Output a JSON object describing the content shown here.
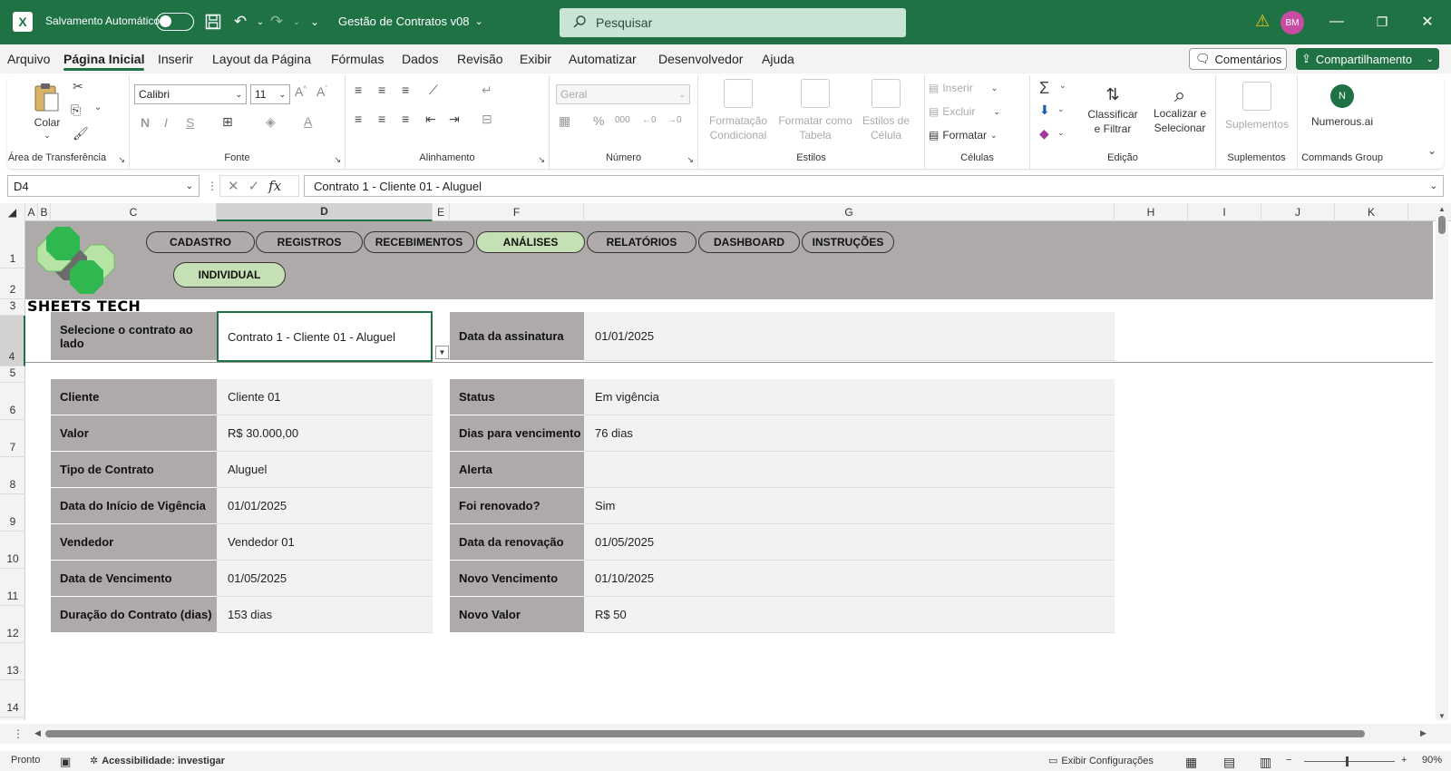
{
  "titlebar": {
    "autosave_label": "Salvamento Automático",
    "doc_title": "Gestão de Contratos v08",
    "search_placeholder": "Pesquisar",
    "avatar_initials": "BM",
    "brand_color": "#1f7244"
  },
  "menu": {
    "items": [
      "Arquivo",
      "Página Inicial",
      "Inserir",
      "Layout da Página",
      "Fórmulas",
      "Dados",
      "Revisão",
      "Exibir",
      "Automatizar",
      "Desenvolvedor",
      "Ajuda"
    ],
    "active": "Página Inicial",
    "comments_label": "Comentários",
    "share_label": "Compartilhamento"
  },
  "ribbon": {
    "clipboard": {
      "paste_label": "Colar",
      "group_label": "Área de Transferência"
    },
    "font": {
      "font_name": "Calibri",
      "font_size": "11",
      "group_label": "Fonte"
    },
    "alignment": {
      "group_label": "Alinhamento"
    },
    "number": {
      "format": "Geral",
      "group_label": "Número"
    },
    "styles": {
      "cond_format": "Formatação Condicional",
      "format_table": "Formatar como Tabela",
      "cell_styles": "Estilos de Célula",
      "group_label": "Estilos"
    },
    "cells": {
      "insert": "Inserir",
      "delete": "Excluir",
      "format": "Formatar",
      "group_label": "Células"
    },
    "editing": {
      "sort_filter": "Classificar e Filtrar",
      "find_select": "Localizar e Selecionar",
      "group_label": "Edição"
    },
    "addins": {
      "label": "Suplementos",
      "group_label": "Suplementos"
    },
    "commands": {
      "label": "Numerous.ai",
      "group_label": "Commands Group"
    }
  },
  "formula_bar": {
    "name_box": "D4",
    "formula": "Contrato 1 - Cliente 01 - Aluguel"
  },
  "columns": [
    "A",
    "B",
    "C",
    "D",
    "E",
    "F",
    "G",
    "H",
    "I",
    "J",
    "K"
  ],
  "selected_column": "D",
  "rows": [
    "1",
    "2",
    "3",
    "4",
    "5",
    "6",
    "7",
    "8",
    "9",
    "10",
    "11",
    "12",
    "13",
    "14"
  ],
  "selected_row": "4",
  "sheet": {
    "brand": "SHEETS TECH",
    "nav": [
      "CADASTRO",
      "REGISTROS",
      "RECEBIMENTOS",
      "ANÁLISES",
      "RELATÓRIOS",
      "DASHBOARD",
      "INSTRUÇÕES"
    ],
    "nav_active": "ANÁLISES",
    "sub_nav": "INDIVIDUAL",
    "select_label": "Selecione o contrato ao lado",
    "select_value": "Contrato 1 - Cliente 01 - Aluguel",
    "signature_label": "Data da assinatura",
    "signature_value": "01/01/2025",
    "left_fields": [
      {
        "label": "Cliente",
        "value": "Cliente 01"
      },
      {
        "label": "Valor",
        "value": "R$ 30.000,00"
      },
      {
        "label": "Tipo de Contrato",
        "value": "Aluguel"
      },
      {
        "label": "Data do Início de Vigência",
        "value": "01/01/2025"
      },
      {
        "label": "Vendedor",
        "value": "Vendedor 01"
      },
      {
        "label": "Data de Vencimento",
        "value": "01/05/2025"
      },
      {
        "label": "Duração do Contrato (dias)",
        "value": "153 dias"
      }
    ],
    "right_fields": [
      {
        "label": "Status",
        "value": "Em vigência"
      },
      {
        "label": "Dias para vencimento",
        "value": "76 dias"
      },
      {
        "label": "Alerta",
        "value": ""
      },
      {
        "label": "Foi renovado?",
        "value": "Sim"
      },
      {
        "label": "Data da renovação",
        "value": "01/05/2025"
      },
      {
        "label": "Novo Vencimento",
        "value": "01/10/2025"
      },
      {
        "label": "Novo Valor",
        "value": "R$ 50"
      }
    ]
  },
  "statusbar": {
    "ready": "Pronto",
    "accessibility": "Acessibilidade: investigar",
    "display_settings": "Exibir Configurações",
    "zoom": "90%"
  }
}
